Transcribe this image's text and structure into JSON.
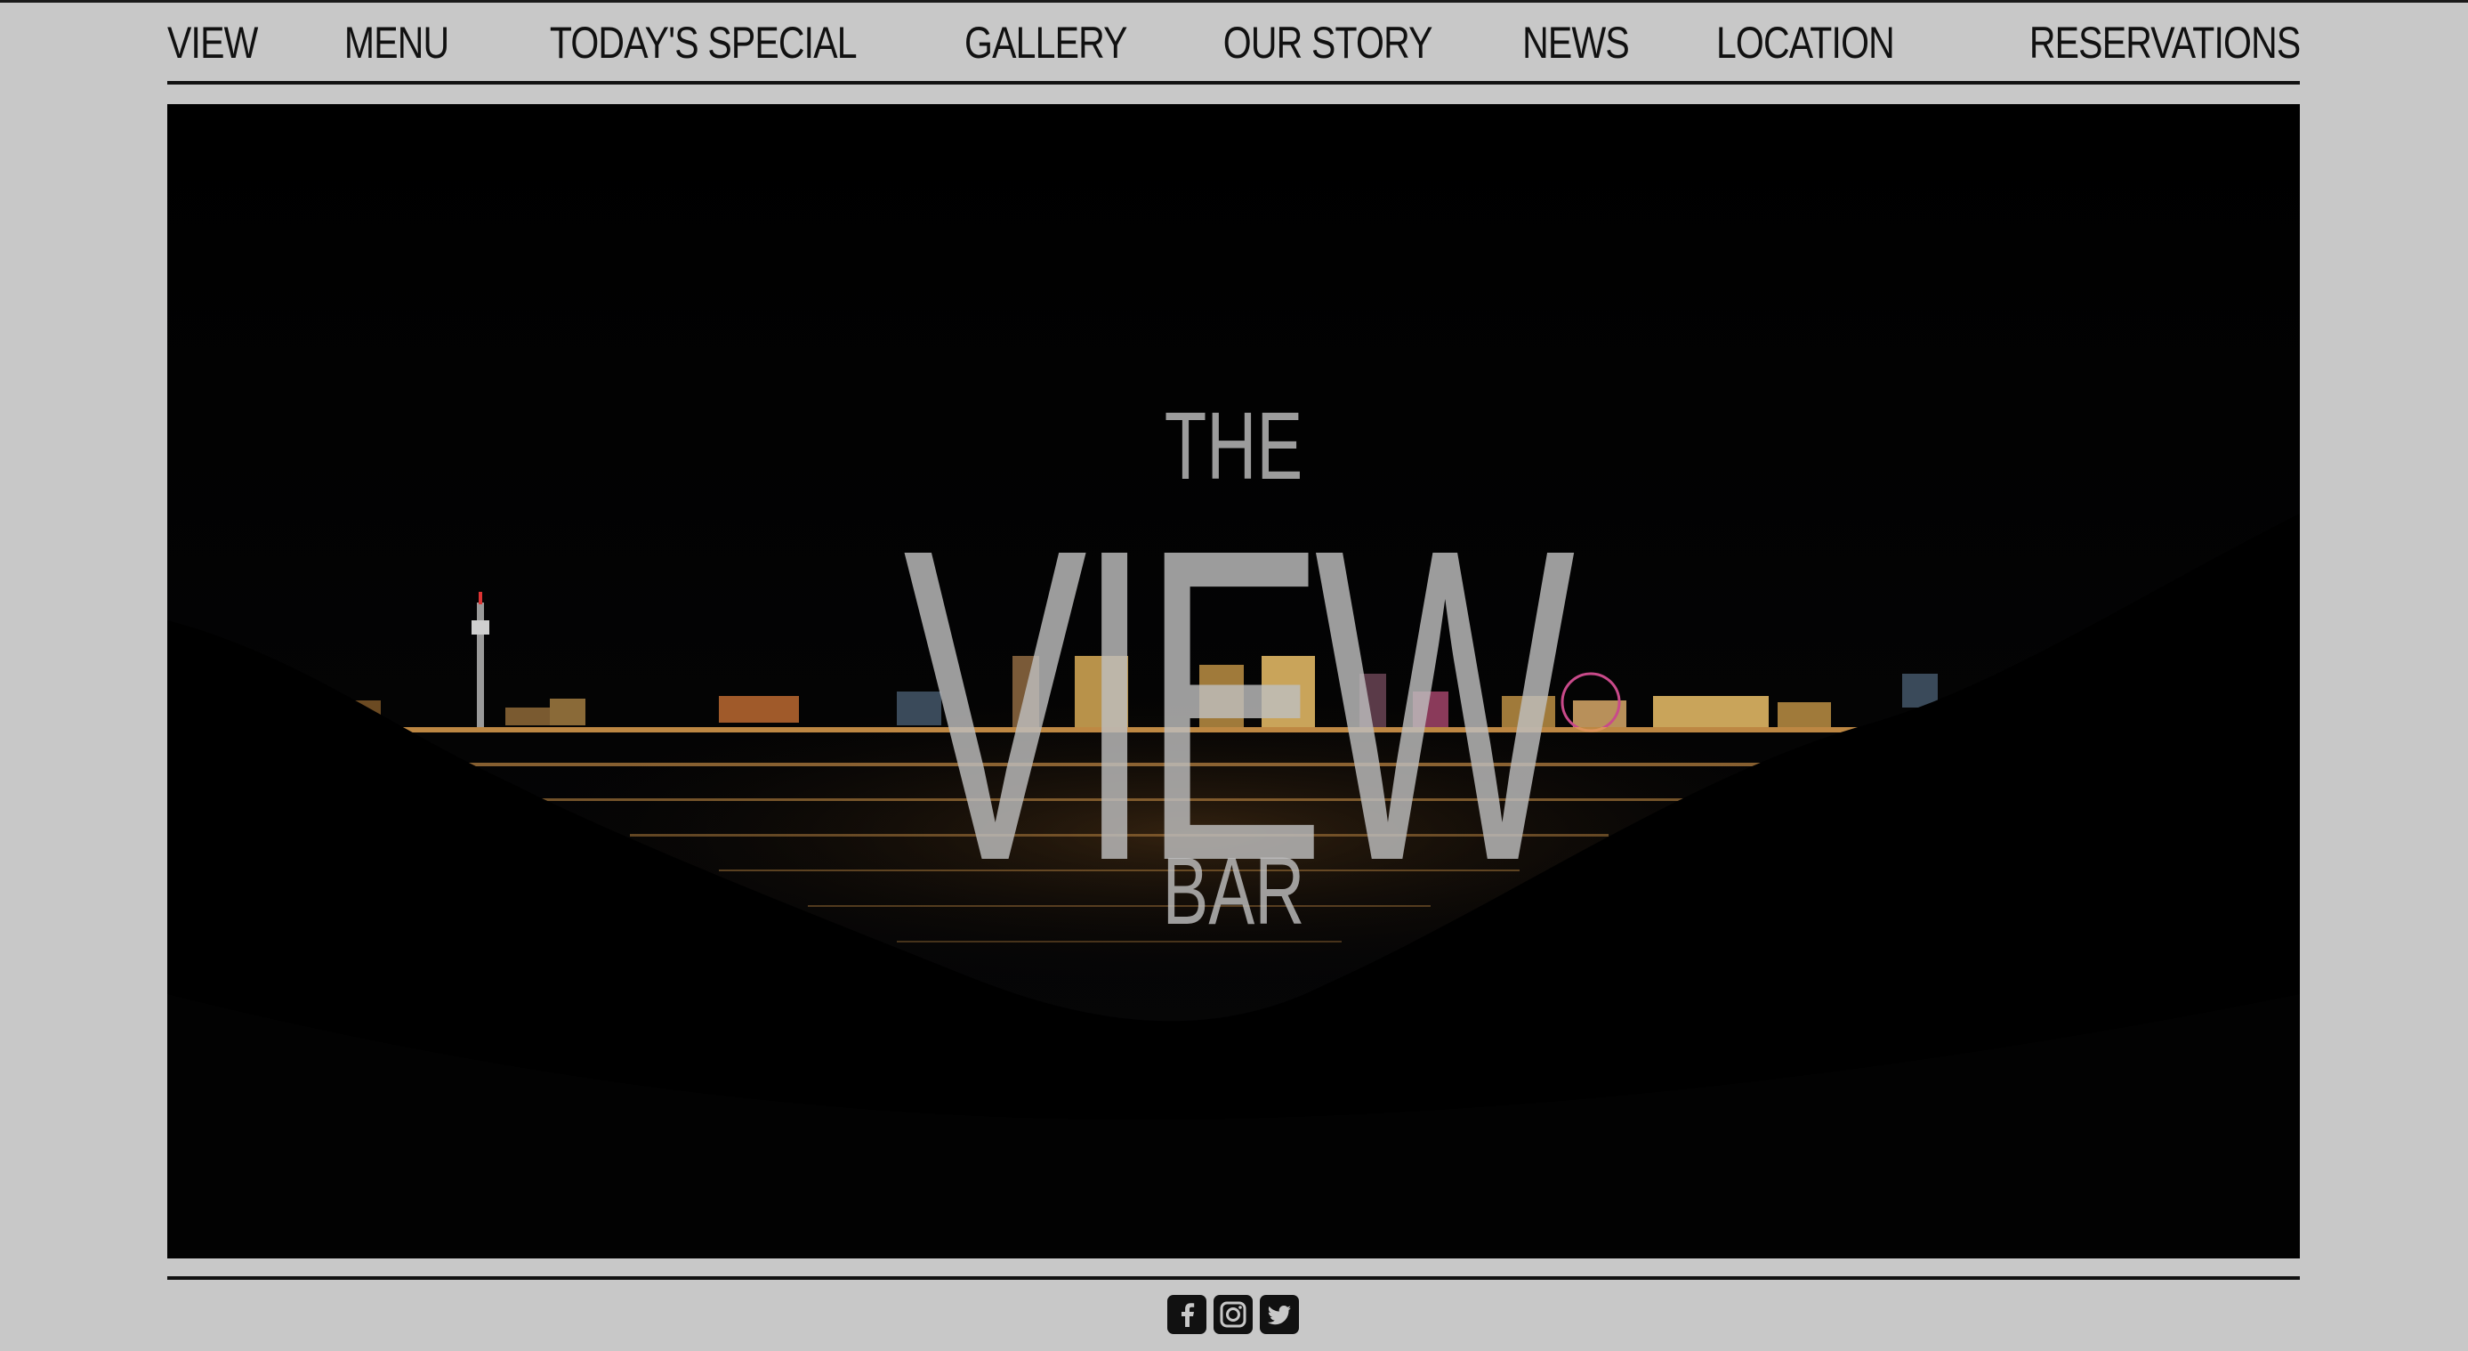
{
  "nav": {
    "items": [
      {
        "label": "VIEW"
      },
      {
        "label": "MENU"
      },
      {
        "label": "TODAY'S SPECIAL"
      },
      {
        "label": "GALLERY"
      },
      {
        "label": "OUR STORY"
      },
      {
        "label": "NEWS"
      },
      {
        "label": "LOCATION"
      },
      {
        "label": "RESERVATIONS"
      }
    ]
  },
  "hero": {
    "title_top": "THE",
    "title_main": "VIEW",
    "title_bottom": "BAR"
  },
  "social": {
    "icons": [
      "facebook-icon",
      "instagram-icon",
      "twitter-icon"
    ]
  },
  "colors": {
    "page_background": "#c8c8c8",
    "nav_text": "#111111",
    "hero_background": "#020202",
    "title_overlay": "#bebebe"
  }
}
